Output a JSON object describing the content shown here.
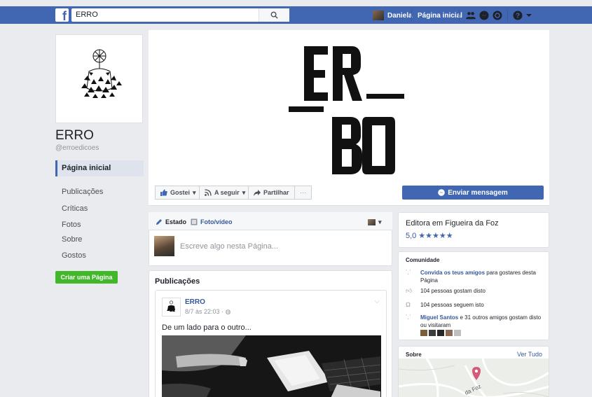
{
  "topbar": {
    "logo": "f",
    "search_value": "ERRO",
    "user_name": "Daniela",
    "home_label": "Página inicial"
  },
  "page": {
    "name": "ERRO",
    "handle": "@erroedicoes"
  },
  "left_nav": {
    "items": [
      {
        "label": "Página inicial"
      },
      {
        "label": "Publicações"
      },
      {
        "label": "Críticas"
      },
      {
        "label": "Fotos"
      },
      {
        "label": "Sobre"
      },
      {
        "label": "Gostos"
      }
    ],
    "create_page": "Criar uma Página"
  },
  "actions": {
    "like": "Gostei",
    "follow": "A seguir",
    "share": "Partilhar",
    "more": "···",
    "message": "Enviar mensagem"
  },
  "composer": {
    "tab_status": "Estado",
    "tab_photo": "Foto/vídeo",
    "placeholder": "Escreve algo nesta Página..."
  },
  "posts": {
    "title": "Publicações",
    "items": [
      {
        "author": "ERRO",
        "time": "8/7 às 22:03 ·",
        "text": "De um lado para o outro..."
      }
    ]
  },
  "about_card": {
    "category": "Editora em Figueira da Foz",
    "rating": "5,0",
    "stars": "★★★★★"
  },
  "community": {
    "title": "Comunidade",
    "invite_link": "Convida os teus amigos",
    "invite_rest": "para gostares desta Página",
    "likes": "104 pessoas gostam disto",
    "follows": "104 pessoas seguem isto",
    "friend_name": "Miguel Santos",
    "friend_rest": "e 31 outros amigos gostam disto ou visitaram"
  },
  "about_section": {
    "title": "Sobre",
    "see_all": "Ver Tudo",
    "map_label": "da Foz"
  },
  "colors": {
    "brand_blue": "#4267b2",
    "green": "#42b72a",
    "link_blue": "#365899"
  }
}
